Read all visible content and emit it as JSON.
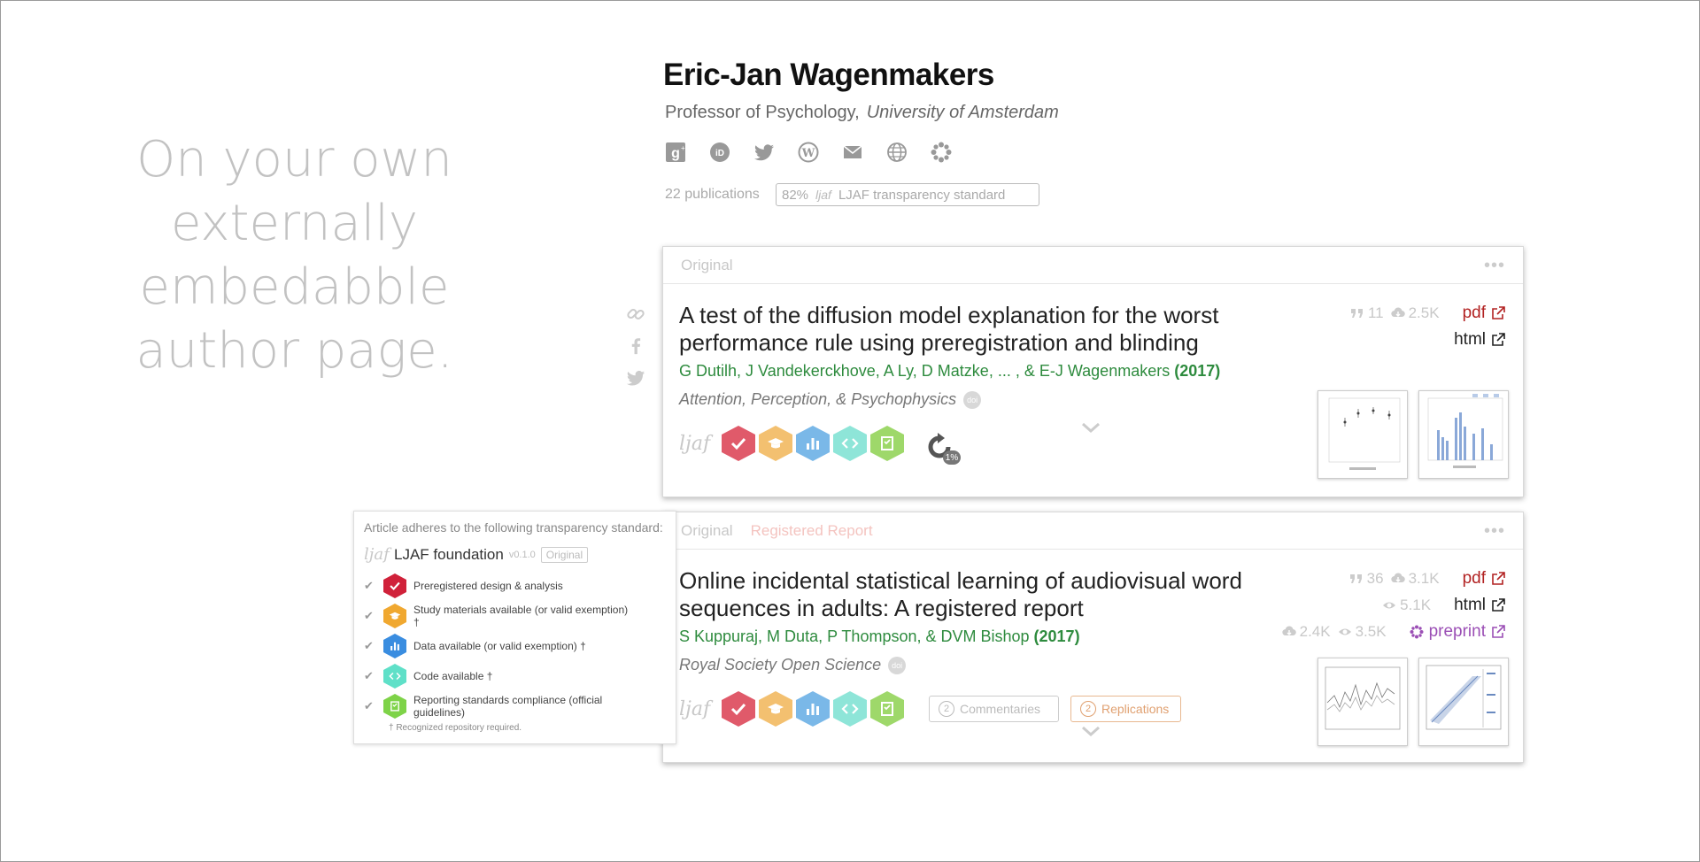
{
  "tagline": "On your own externally embedabble author page.",
  "author": {
    "name": "Eric-Jan Wagenmakers",
    "title": "Professor of Psychology,",
    "institution": "University of Amsterdam",
    "social_icons": [
      "google-scholar-icon",
      "orcid-icon",
      "twitter-icon",
      "wordpress-icon",
      "email-icon",
      "website-icon",
      "osf-icon"
    ],
    "publications": "22 publications",
    "standard_badge": {
      "percent": "82%",
      "logo": "ljaf",
      "label": "LJAF transparency standard"
    }
  },
  "share_icons": [
    "link-icon",
    "facebook-icon",
    "twitter-icon"
  ],
  "papers": [
    {
      "tabs": [
        "Original"
      ],
      "title": "A test of the diffusion model explanation for the worst performance rule using preregistration and blinding",
      "authors": "G Dutilh, J Vandekerckhove, A Ly, D Matzke, ... , & E-J Wagenmakers",
      "year": "(2017)",
      "journal": "Attention, Perception, & Psychophysics",
      "doi": "doi",
      "citations": "11",
      "downloads": "2.5K",
      "links": [
        "pdf",
        "html"
      ],
      "replication_pct": "1%"
    },
    {
      "tabs": [
        "Original",
        "Registered Report"
      ],
      "title": "Online incidental statistical learning of audiovisual word sequences in adults: A registered report",
      "authors": "S Kuppuraj, M Duta, P Thompson, & DVM Bishop",
      "year": "(2017)",
      "journal": "Royal Society Open Science",
      "doi": "doi",
      "citations": "36",
      "downloads": "3.1K",
      "views": "5.1K",
      "preprint_downloads": "2.4K",
      "preprint_views": "3.5K",
      "links": [
        "pdf",
        "html",
        "preprint"
      ],
      "commentaries": {
        "count": "2",
        "label": "Commentaries"
      },
      "replications": {
        "count": "2",
        "label": "Replications"
      }
    }
  ],
  "badges": [
    {
      "name": "preregistered",
      "color": "#e05a6a"
    },
    {
      "name": "materials",
      "color": "#f3c070"
    },
    {
      "name": "data",
      "color": "#7ab8e8"
    },
    {
      "name": "code",
      "color": "#8ee5d8"
    },
    {
      "name": "reporting",
      "color": "#9ed86a"
    }
  ],
  "popup": {
    "heading": "Article adheres to the following transparency standard:",
    "logo": "ljaf",
    "name": "LJAF foundation",
    "version": "v0.1.0",
    "tag": "Original",
    "items": [
      {
        "label": "Preregistered design & analysis",
        "color": "#d0213a"
      },
      {
        "label": "Study materials available (or valid exemption) †",
        "color": "#f0a830"
      },
      {
        "label": "Data available (or valid exemption) †",
        "color": "#3a8de0"
      },
      {
        "label": "Code available †",
        "color": "#5fe0c8"
      },
      {
        "label": "Reporting standards compliance  (official guidelines)",
        "color": "#7ed348"
      }
    ],
    "footnote": "† Recognized repository required."
  }
}
